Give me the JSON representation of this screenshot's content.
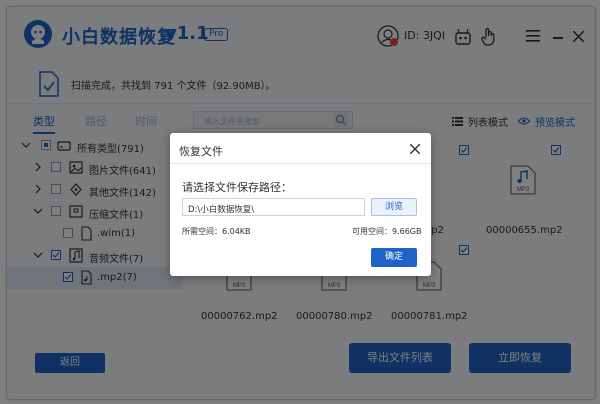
{
  "app": {
    "title": "小白数据恢复",
    "version": "v1.1",
    "badge": "Pro",
    "user_id": "ID: 3JQI",
    "accent_color": "#1f63c6"
  },
  "status": {
    "text": "扫描完成，共找到 791 个文件（92.90MB）。"
  },
  "tabs": [
    {
      "label": "类型",
      "active": true
    },
    {
      "label": "路径",
      "active": false
    },
    {
      "label": "时间",
      "active": false
    }
  ],
  "search": {
    "placeholder": "输入文件名搜索"
  },
  "view": {
    "list_label": "列表模式",
    "preview_label": "预览模式"
  },
  "tree": [
    {
      "label": "所有类型(791)",
      "icon": "drive-icon"
    },
    {
      "label": "图片文件(641)",
      "icon": "image-icon"
    },
    {
      "label": "其他文件(142)",
      "icon": "diamond-icon"
    },
    {
      "label": "压缩文件(1)",
      "icon": "archive-icon"
    },
    {
      "label": ".wim(1)",
      "icon": "file-icon"
    },
    {
      "label": "音频文件(7)",
      "icon": "music-icon"
    },
    {
      "label": ".mp2(7)",
      "icon": "music-file-icon"
    }
  ],
  "files": [
    {
      "name": "00000655.mp2",
      "ext": "MP3"
    },
    {
      "name": "00000762.mp2",
      "ext": "MP3"
    },
    {
      "name": "00000780.mp2",
      "ext": "MP3"
    },
    {
      "name": "00000781.mp2",
      "ext": "MP3"
    },
    {
      "name": "...mp2",
      "ext": "MP3"
    }
  ],
  "buttons": {
    "back": "返回",
    "export": "导出文件列表",
    "recover": "立即恢复"
  },
  "dialog": {
    "title": "恢复文件",
    "prompt": "请选择文件保存路径：",
    "path_value": "D:\\小白数据恢复\\",
    "browse": "浏览",
    "space_needed": "所需空间：6.04KB",
    "space_available": "可用空间：9.66GB",
    "confirm": "确定"
  }
}
